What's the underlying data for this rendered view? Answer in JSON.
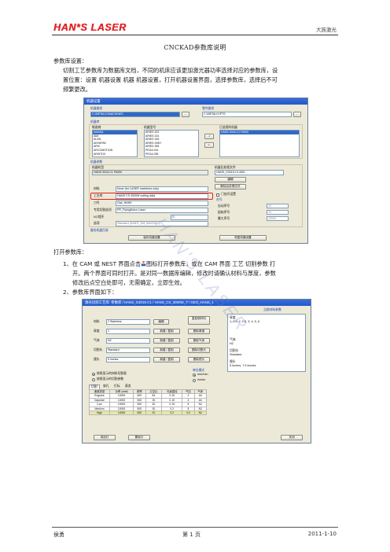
{
  "header": {
    "logo": "HAN*S LASER",
    "company": "大族激光"
  },
  "doc_title": "CNCKAD参数库说明",
  "section1": {
    "heading": "参数库设置：",
    "body_line1": "切割工艺参数库为数据库文档，不同的机床应该更加激光器功率选择对应的参数库，设",
    "body_line2": "置位置：设置 机器设置 机器 机器设置，打开机器设置界面，选择参数库，选择后不可",
    "body_line3": "频繁更改。"
  },
  "machine_dialog": {
    "title": "机器设置",
    "machine_path_label": "机器路径",
    "machine_path_value": "C:\\METALIX\\MACHINES",
    "browse_button": "...",
    "part_path_label": "零件路径",
    "part_path_value": "C:\\METALIX\\PTS",
    "machine_library_label": "机器库",
    "manufacturer_label": "制造商",
    "manufacturers": [
      "AMADA",
      "AIM",
      "ALAN",
      "ANYAPAK",
      "ARIC",
      "ARCOMOTION",
      "ARISTO3",
      "AG"
    ],
    "machine_model_label": "机器型号",
    "models": [
      "ARIES 202",
      "ARIES 224",
      "ARIES 245",
      "ARIES 245H",
      "ARIES 255",
      "PEGA 244",
      "PEGA 255",
      "PEGA 344",
      "PEGA 345"
    ],
    "add_arrow": "->",
    "remove_arrow": "<-",
    "installed_label": "已选用的机器",
    "installed_item": "HANS 3015-C1 F6000",
    "machine_params_label": "机器参数",
    "machine_name_label": "机器机型",
    "machine_name_value": "HANS 3015-C1 F6000",
    "material_label": "材料",
    "material_value": "None (for LASER machines only)",
    "process_label": "工艺库",
    "process_value": "HANS CS 3000W cutting data",
    "head_label": "刀号",
    "head_value": "Gas_HANS",
    "technology_label": "专用切割选项",
    "technology_value": "PR_FlyingDotcu Laser",
    "nc_label": "NC程序",
    "nc_value": "G",
    "options_label": "选项",
    "options_value": "Standard (HAN'S_GM_MACHS...)",
    "post_label": "机器后处理文件",
    "post_value": "HANS_G3015-C1.MDL",
    "edit_button": "编辑",
    "delete_post_button": "删除后处理文件",
    "auto_id_label": "门加号设置",
    "table_label": "台号",
    "auto_number": "自动序号",
    "start_value": "起始序号",
    "max_value": "最大序号",
    "auto_val": "10",
    "start_val": "10",
    "max_val": "10000",
    "backup_label": "备份机器目录",
    "save_settings_button": "保存机器设置",
    "restore_settings_button": "恢复机器设置"
  },
  "section2": {
    "heading": "打开参数库：",
    "step1_line1a": "1、在 CAM 或 NEST 界面点击",
    "step1_line1b": "图标打开参数库，或在 CAM 界面 工艺 切割参数 打",
    "step1_line2": "开。两个界面可同时打开。是对同一数据库编辑，修改时请确认材料与厚度，参数",
    "step1_line3": "修改后点空白处即可，无需确定，立即生效。",
    "step2": "2、参数库界面如下："
  },
  "param_dialog": {
    "title": "激光切割工艺库: 参数库 / HANS_G3015-C1 / HANS_CS_3000W_T / GEO_HANS_1",
    "process_info_label": "当前材料参数",
    "material_label": "材料",
    "material_value": "2 Stainless",
    "thickness_label": "厚度",
    "thickness_value": "1",
    "gas_label": "气体",
    "gas_value": "N2",
    "cutting_label": "切割头",
    "cutting_value": "Standard",
    "lens_label": "镜头",
    "lens_value": "5 inches",
    "edit_button": "编辑",
    "new_button": "新建 / 复制",
    "delete_material": "删除材料",
    "delete_thickness": "删除厚度",
    "delete_gas": "删除气体",
    "delete_head": "删除切割头",
    "delete_lens": "删除镜头",
    "copy_material": "复制原材料",
    "right_thick_label": "厚度",
    "right_thick_value": "1, 1.5, 2, 2.5, 3, 4, 5, 6",
    "right_gas_label": "气体",
    "right_gas_value": "N2",
    "right_head_label": "切割头",
    "right_head_value": "Standard",
    "right_lens_label": "镜头",
    "right_lens_value": "5 inches, 7.5 inches",
    "radio_sort_label": "单位模式",
    "radio_mm": "mm/min",
    "radio_inch": "in/min",
    "check1": "按照显示的材料切割表",
    "check2": "按照显示的切割参数",
    "tabs": [
      "切割",
      "穿孔",
      "打标",
      "蒸发"
    ],
    "table_headers": [
      "速度类型",
      "功率 (watt)",
      "频率",
      "占空比",
      "光束直径",
      "气压",
      "气体"
    ],
    "table_rows": [
      [
        "Engrave",
        "10000",
        "500",
        "84",
        "0.15",
        "2",
        "Air"
      ],
      [
        "Vaporize",
        "10000",
        "500",
        "30",
        "0.15",
        "4",
        "Air"
      ],
      [
        "Low",
        "10000",
        "500",
        "30",
        "0.15",
        "8",
        "N2"
      ],
      [
        "Medium",
        "10000",
        "500",
        "30",
        "0.2",
        "8",
        "N2"
      ],
      [
        "High",
        "10000",
        "500",
        "31",
        "0.2",
        "3.0",
        "N2"
      ]
    ],
    "add_button": "添加行",
    "delete_button": "删除行",
    "close_button": "关闭"
  },
  "watermark": "HAN'S  LASER",
  "footer": {
    "author": "侯勇",
    "page_prefix": "第",
    "page_number": "1",
    "page_suffix": "页",
    "date": "2011-1-10"
  }
}
